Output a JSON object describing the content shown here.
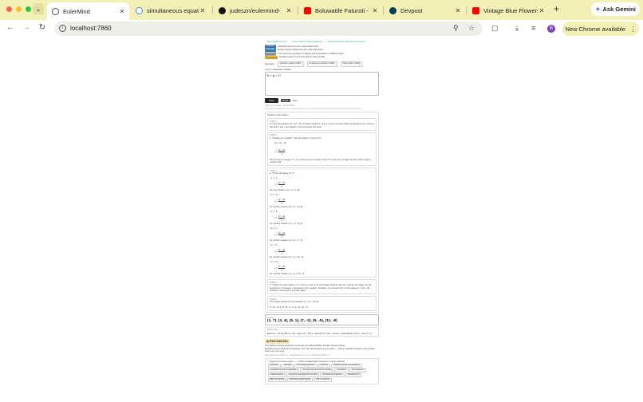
{
  "browser": {
    "tabs": [
      {
        "label": "EulerMind",
        "active": true,
        "favicon": "globe-icon",
        "color": "#555555"
      },
      {
        "label": "simultaneous equatio",
        "favicon": "google-icon",
        "color": "#4285f4"
      },
      {
        "label": "judeszn/eulermind-",
        "favicon": "github-icon",
        "color": "#111111"
      },
      {
        "label": "Boluwatife Faturoti -",
        "favicon": "youtube-icon",
        "color": "#ff0000"
      },
      {
        "label": "Devpost",
        "favicon": "devpost-icon",
        "color": "#003e54"
      },
      {
        "label": "Vintage Blue Flowers",
        "favicon": "youtube-icon",
        "color": "#ff0000"
      }
    ],
    "ask_gemini": "Ask Gemini",
    "url": "localhost:7860",
    "new_chrome": "New Chrome available",
    "avatar_letter": "B"
  },
  "app": {
    "links": [
      "✓ Meta-cultural theories",
      "✓ Due to solving closed-guidelines",
      "✓ Check for problem: Excerpts input of text"
    ],
    "badges": [
      {
        "label": "WARNING",
        "text": "Guarded inputs from this mathematical input",
        "color": "#3a6ea5"
      },
      {
        "label": "VERIFIED",
        "text": "Verified solution follows the input math submission",
        "color": "#2c7fb8"
      },
      {
        "label": "WARNING",
        "text": "This model can generate to evaluate and the behaviour conflicted output",
        "color": "#888888"
      },
      {
        "label": "LOAD LIMIT",
        "text": "Possible source to and this problem solve formally",
        "color": "#c9a227"
      }
    ],
    "examples_label": "Examples:",
    "examples": [
      "Quadratic equation (NEW)",
      "Simultaneous equations (NEW)",
      "Differentiation (NEW)"
    ],
    "input_label": "Input a mathematics problem",
    "input_value": "3x + 4y = 47",
    "solve_label": "Solve",
    "simple_label": "Simple",
    "clear_label": "Clear",
    "hint_line_1": "Quote the solution · More details",
    "hint_line_2": "The solution above are the model explanation. View the final solution with the technical view to fully derive",
    "steps_header": "Solution to the problem",
    "steps": [
      {
        "title": "STEP 1",
        "body": "To solve the equation 3x + 4y = 47 for integer values of x and y, we can use the method of trial and error, ensuring that both x and y are integers. Let's go through the steps:"
      },
      {
        "title": "STEP 2",
        "body": "1. **Isolate one variable**: We can isolate y in terms of x:"
      },
      {
        "title": "STEP 3",
        "body": "This is to be an integer. 47 - 3x must be an even number. Since 47 is odd, 3x must also be odd, which means x must be odd."
      },
      {
        "title": "STEP 4",
        "body": "2. **Find odd values for x**:"
      },
      {
        "title": "STEP 5",
        "body": "3. **Check for other values of x**: Since x must be an odd integer and the value of y must be an integer, we can see that as x increases, y decreases more negative. Therefore, we can stop here as the values of x and y will continue to decrease in a similar pattern."
      },
      {
        "title": "STEP 6",
        "body": "The integer solutions to the equation 3x + 4y = 47 are:"
      }
    ],
    "math": {
      "isolate": "4y = 47 - 3x",
      "y_eq": "y =",
      "y_num": "47 - 3x",
      "y_den": "4",
      "x_values": [
        {
          "x": "- If x = 1:",
          "sol": "So, one solution is (x, y) = (1, 11)."
        },
        {
          "x": "- If x = 3:",
          "sol": "So, another solution is (x, y) = (3, 8)."
        },
        {
          "x": "- If x = 5:",
          "sol": "So, another solution is (x, y) = (5, 5)."
        },
        {
          "x": "- If x = 7:",
          "sol": "So, another solution is (x, y) = (7, 2)."
        },
        {
          "x": "- If x = 9:",
          "sol": "So, another solution is (x, y) = (9, -1)."
        },
        {
          "x": "- If x = 11:",
          "sol": "So, another solution is (x, y) = (11, -4)."
        }
      ],
      "solutions_line": "(1, 11), (3, 8), (5, 5), (7, 2), (9, -5), (11, -8)"
    },
    "answer_label": "Answer",
    "answer_value": "(1, 7), (3, 4), (5, 1), (7, -2), (9, -5), (11, -8)",
    "model_label": "Model trace",
    "model_text": "Result: EulerMind can explain this question and cannot mathematically check it",
    "ai_label": "AI EXPLANATION",
    "ai_text_1": "This solution was generated by AI and was not mathematically checked. Need verifying.",
    "ai_text_2": "EulerMind shows all kinds of questions. The user should take a copy of them — click to read about what to verify, please check your own work.",
    "ai_text_3": "Generation time 2082 ms · Verification time 0 ms · Extraction 0822 ms",
    "topics_label": "✓ Supported question types — ✓ Kinds of mathematics questions currently included",
    "topics": [
      "Arithmetic",
      "Averages",
      "Percentage questions",
      "Fractions",
      "Equations (linear and quadratic)",
      "Inequalities (linear and quadratic)",
      "Proving sequences and formulating",
      "Inequalities",
      "Set operations",
      "Transformations",
      "Sequences and algebraic formulas",
      "Simultaneous equations",
      "Standard form",
      "Rates of increase",
      "Factorising graph shapes",
      "Unit conversions"
    ]
  }
}
